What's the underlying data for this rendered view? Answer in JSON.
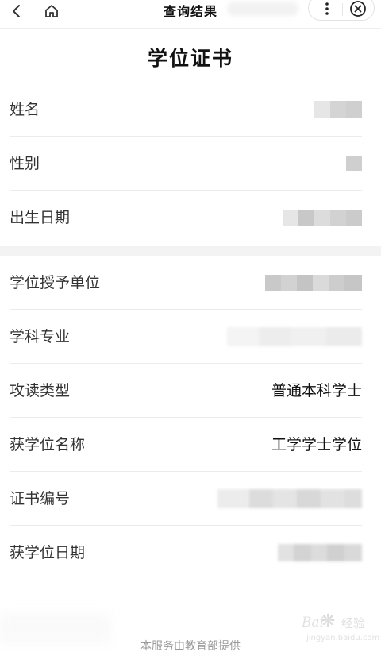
{
  "topbar": {
    "title": "查询结果",
    "icons": [
      "chevron-left-icon",
      "home-icon",
      "more-vertical-icon",
      "close-circle-icon"
    ]
  },
  "page": {
    "heading": "学位证书"
  },
  "personal_info": [
    {
      "label": "姓名",
      "value": ""
    },
    {
      "label": "性别",
      "value": ""
    },
    {
      "label": "出生日期",
      "value": ""
    }
  ],
  "degree_info": [
    {
      "label": "学位授予单位",
      "value": ""
    },
    {
      "label": "学科专业",
      "value": ""
    },
    {
      "label": "攻读类型",
      "value": "普通本科学士"
    },
    {
      "label": "获学位名称",
      "value": "工学学士学位"
    },
    {
      "label": "证书编号",
      "value": ""
    },
    {
      "label": "获学位日期",
      "value": ""
    }
  ],
  "footer": {
    "text": "本服务由教育部提供"
  },
  "watermark": {
    "brand": "Bai",
    "brand2": "经验",
    "sub": "jingyan.baidu.com"
  },
  "colors": {
    "background": "#ffffff",
    "section_gap": "#f3f3f3",
    "divider": "#ececec",
    "label_text": "#333333",
    "value_text": "#111111",
    "footer_text": "#9a9a9a"
  }
}
